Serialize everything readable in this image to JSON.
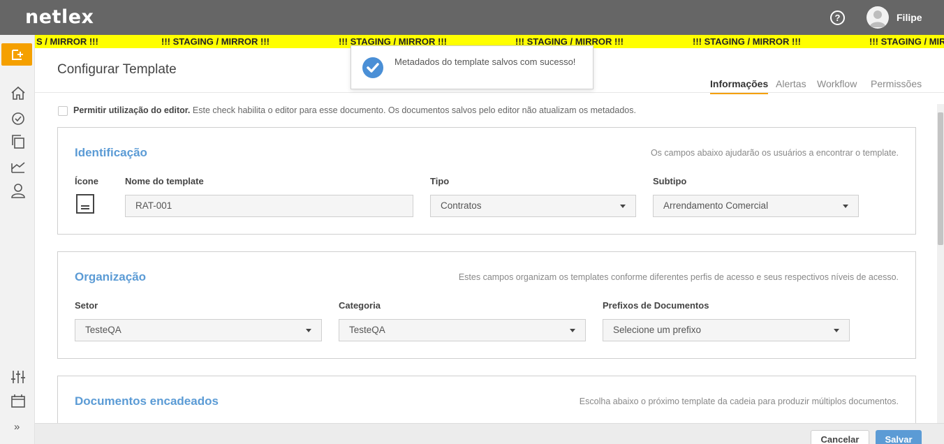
{
  "header": {
    "logo": "netlex",
    "user_name": "Filipe"
  },
  "staging_banner": [
    "S / MIRROR !!!",
    "!!! STAGING / MIRROR !!!",
    "!!! STAGING / MIRROR !!!",
    "!!! STAGING / MIRROR !!!",
    "!!! STAGING / MIRROR !!!",
    "!!! STAGING / MIRROR !!!"
  ],
  "sidebar": {
    "icons": [
      "new-template-icon",
      "home-icon",
      "dashboard-icon",
      "documents-icon",
      "reports-icon",
      "user-icon",
      "settings-sliders-icon",
      "archive-icon",
      "expand-icon"
    ],
    "expand_label": "»"
  },
  "page": {
    "title": "Configurar Template",
    "tabs": [
      "Informações",
      "Alertas",
      "Workflow",
      "Permissões"
    ],
    "active_tab": "Informações"
  },
  "editor_option": {
    "label": "Permitir utilização do editor.",
    "description": " Este check habilita o editor para esse documento. Os documentos salvos pelo editor não atualizam os metadados.",
    "checked": false
  },
  "identificacao": {
    "title": "Identificação",
    "description": "Os campos abaixo ajudarão os usuários a encontrar o template.",
    "icon_label": "Ícone",
    "name_label": "Nome do template",
    "name_value": "RAT-001",
    "tipo_label": "Tipo",
    "tipo_value": "Contratos",
    "subtipo_label": "Subtipo",
    "subtipo_value": "Arrendamento Comercial"
  },
  "organizacao": {
    "title": "Organização",
    "description": "Estes campos organizam os templates conforme diferentes perfis de acesso e seus respectivos níveis de acesso.",
    "setor_label": "Setor",
    "setor_value": "TesteQA",
    "categoria_label": "Categoria",
    "categoria_value": "TesteQA",
    "prefixos_label": "Prefixos de Documentos",
    "prefixos_placeholder": "Selecione um prefixo"
  },
  "encadeados": {
    "title": "Documentos encadeados",
    "description": "Escolha abaixo o próximo template da cadeia para produzir múltiplos documentos."
  },
  "footer": {
    "cancel_label": "Cancelar",
    "save_label": "Salvar"
  },
  "toast": {
    "message": "Metadados do template salvos com sucesso!"
  },
  "colors": {
    "accent": "#f5a000",
    "primary": "#5b9bd5",
    "topbar": "#666666",
    "banner": "#ffff00"
  }
}
